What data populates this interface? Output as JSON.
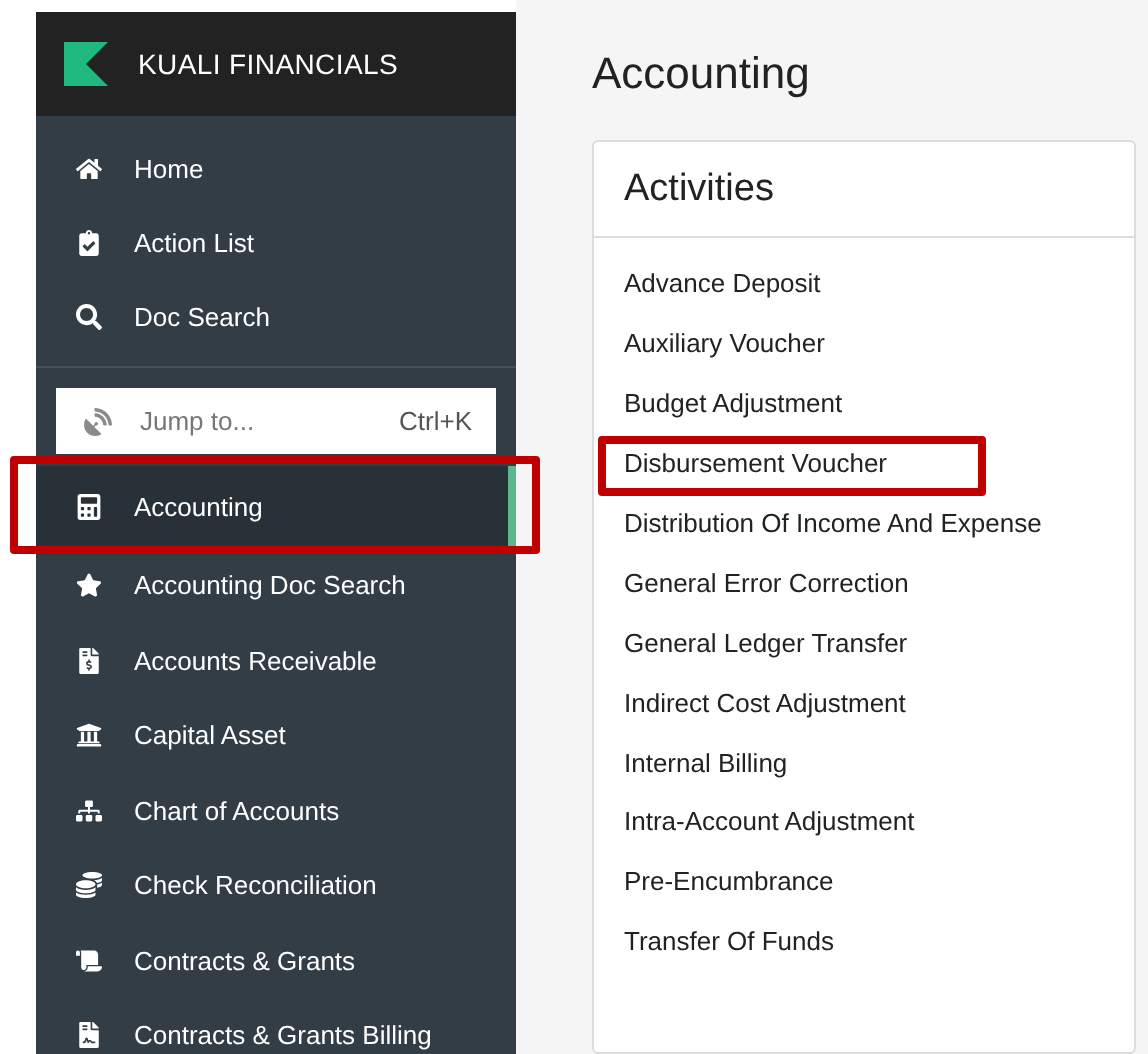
{
  "brand": {
    "name": "KUALI FINANCIALS"
  },
  "nav_top": [
    {
      "label": "Home"
    },
    {
      "label": "Action List"
    },
    {
      "label": "Doc Search"
    }
  ],
  "jump": {
    "placeholder": "Jump to...",
    "shortcut": "Ctrl+K"
  },
  "nav_modules": [
    {
      "label": "Accounting",
      "selected": true,
      "highlighted": true
    },
    {
      "label": "Accounting Doc Search",
      "selected": false,
      "highlighted": false
    },
    {
      "label": "Accounts Receivable",
      "selected": false,
      "highlighted": false
    },
    {
      "label": "Capital Asset",
      "selected": false,
      "highlighted": false
    },
    {
      "label": "Chart of Accounts",
      "selected": false,
      "highlighted": false
    },
    {
      "label": "Check Reconciliation",
      "selected": false,
      "highlighted": false
    },
    {
      "label": "Contracts & Grants",
      "selected": false,
      "highlighted": false
    },
    {
      "label": "Contracts & Grants Billing",
      "selected": false,
      "highlighted": false
    }
  ],
  "page_title": "Accounting",
  "card": {
    "title": "Activities",
    "links": [
      {
        "label": "Advance Deposit",
        "highlighted": false
      },
      {
        "label": "Auxiliary Voucher",
        "highlighted": false
      },
      {
        "label": "Budget Adjustment",
        "highlighted": false
      },
      {
        "label": "Disbursement Voucher",
        "highlighted": true
      },
      {
        "label": "Distribution Of Income And Expense",
        "highlighted": false
      },
      {
        "label": "General Error Correction",
        "highlighted": false
      },
      {
        "label": "General Ledger Transfer",
        "highlighted": false
      },
      {
        "label": "Indirect Cost Adjustment",
        "highlighted": false
      },
      {
        "label": "Internal Billing",
        "highlighted": false
      },
      {
        "label": "Intra-Account Adjustment",
        "highlighted": false
      },
      {
        "label": "Pre-Encumbrance",
        "highlighted": false
      },
      {
        "label": "Transfer Of Funds",
        "highlighted": false
      }
    ]
  }
}
